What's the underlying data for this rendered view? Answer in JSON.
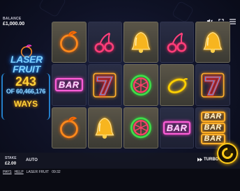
{
  "balance": {
    "label": "BALANCE",
    "value": "£1,000.00"
  },
  "top_icons": [
    "mute-icon",
    "fullscreen-icon",
    "menu-icon"
  ],
  "logo": {
    "line1": "LASER",
    "line2": "FRUIT"
  },
  "ways": {
    "count": "243",
    "of_text": "OF 60,466,176",
    "label": "WAYS"
  },
  "reels": [
    [
      "orange",
      "bar",
      "orange"
    ],
    [
      "cherry",
      "seven",
      "bell"
    ],
    [
      "bell",
      "watermelon",
      "watermelon"
    ],
    [
      "cherry",
      "lemon",
      "bar"
    ],
    [
      "bell",
      "seven",
      "triple-bar"
    ]
  ],
  "symbol_text": {
    "bar": "BAR"
  },
  "stake": {
    "label": "STAKE",
    "value": "£2.00"
  },
  "auto_label": "AUTO",
  "turbo_label": "TURBO",
  "footer": {
    "paytable": "PAYS",
    "help": "HELP",
    "game_name": "LASER FRUIT",
    "time": "09:32"
  },
  "colors": {
    "accent_gold": "#ffcc1a",
    "neon_blue": "#2ca3ff",
    "neon_pink": "#ff3fd0"
  }
}
